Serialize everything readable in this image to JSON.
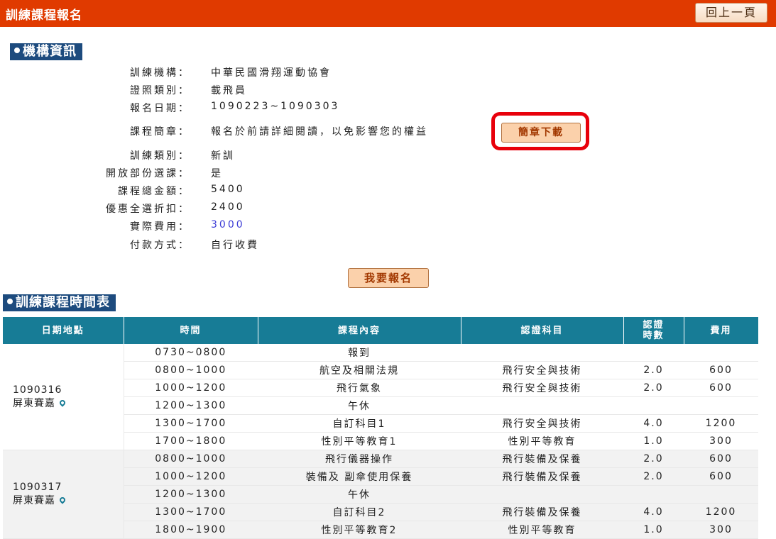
{
  "header": {
    "title": "訓練課程報名",
    "back_label": "回上一頁"
  },
  "section1": {
    "title": "機構資訊"
  },
  "info": [
    {
      "label": "訓練機構：",
      "value": "中華民國滑翔運動協會"
    },
    {
      "label": "證照類別：",
      "value": "載飛員"
    },
    {
      "label": "報名日期：",
      "value": "1090223~1090303"
    },
    {
      "label": "課程簡章：",
      "value": "報名於前請詳細閱讀，以免影響您的權益"
    },
    {
      "label": "訓練類別：",
      "value": "新訓"
    },
    {
      "label": "開放部份選課：",
      "value": "是"
    },
    {
      "label": "課程總金額：",
      "value": "5400"
    },
    {
      "label": "優惠全選折扣：",
      "value": "2400"
    },
    {
      "label": "實際費用：",
      "value": "3000"
    },
    {
      "label": "付款方式：",
      "value": "自行收費"
    }
  ],
  "download_label": "簡章下載",
  "signup_label": "我要報名",
  "section2": {
    "title": "訓練課程時間表"
  },
  "table": {
    "headers": [
      "日期地點",
      "時間",
      "課程內容",
      "認證科目",
      "認證\n時數",
      "費用"
    ],
    "groups": [
      {
        "date": "1090316",
        "place": "屏東賽嘉",
        "rows": [
          [
            "0730~0800",
            "報到",
            "",
            "",
            ""
          ],
          [
            "0800~1000",
            "航空及相關法規",
            "飛行安全與技術",
            "2.0",
            "600"
          ],
          [
            "1000~1200",
            "飛行氣象",
            "飛行安全與技術",
            "2.0",
            "600"
          ],
          [
            "1200~1300",
            "午休",
            "",
            "",
            ""
          ],
          [
            "1300~1700",
            "自訂科目1",
            "飛行安全與技術",
            "4.0",
            "1200"
          ],
          [
            "1700~1800",
            "性別平等教育1",
            "性別平等教育",
            "1.0",
            "300"
          ]
        ]
      },
      {
        "date": "1090317",
        "place": "屏東賽嘉",
        "rows": [
          [
            "0800~1000",
            "飛行儀器操作",
            "飛行裝備及保養",
            "2.0",
            "600"
          ],
          [
            "1000~1200",
            "裝備及 副傘使用保養",
            "飛行裝備及保養",
            "2.0",
            "600"
          ],
          [
            "1200~1300",
            "午休",
            "",
            "",
            ""
          ],
          [
            "1300~1700",
            "自訂科目2",
            "飛行裝備及保養",
            "4.0",
            "1200"
          ],
          [
            "1800~1900",
            "性別平等教育2",
            "性別平等教育",
            "1.0",
            "300"
          ]
        ]
      }
    ]
  }
}
